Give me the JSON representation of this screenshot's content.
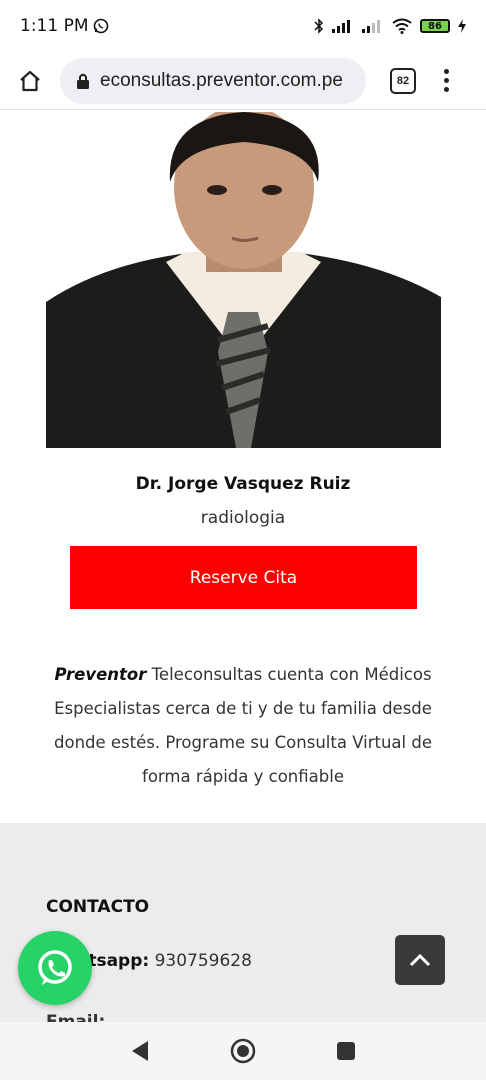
{
  "status_bar": {
    "time": "1:11 PM",
    "battery": "86",
    "icons": [
      "whatsapp-icon",
      "bluetooth-icon",
      "signal-icon",
      "signal-icon",
      "wifi-icon",
      "battery-icon",
      "charging-icon"
    ]
  },
  "browser": {
    "url": "econsultas.preventor.com.pe",
    "tab_count": "82"
  },
  "doctor": {
    "name": "Dr. Jorge Vasquez Ruiz",
    "specialty": "radiologia",
    "reserve_label": "Reserve Cita"
  },
  "description": {
    "brand": "Preventor",
    "text": " Teleconsultas cuenta con Médicos Especialistas cerca de ti y de tu familia desde donde estés. Programe su Consulta Virtual de forma rápida y confiable"
  },
  "footer": {
    "contact_title": "CONTACTO",
    "whatsapp_label": "Whatsapp:",
    "whatsapp_number": " 930759628",
    "email_label": "Email:"
  },
  "colors": {
    "reserve_button": "#ff0000",
    "whatsapp_fab": "#25d366",
    "footer_bg": "#ececec"
  }
}
